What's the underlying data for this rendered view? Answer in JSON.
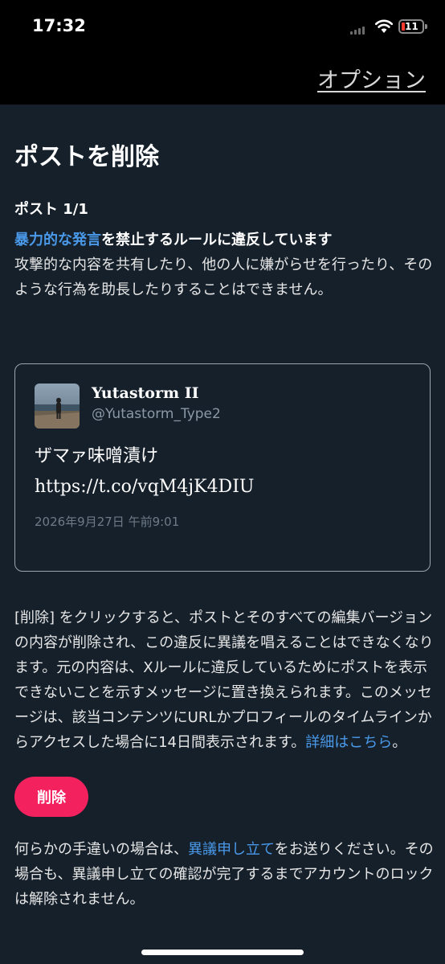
{
  "status_bar": {
    "time": "17:32",
    "battery": "11"
  },
  "header": {
    "options_label": "オプション"
  },
  "page": {
    "title": "ポストを削除",
    "post_count": "ポスト 1/1",
    "violation_link": "暴力的な発言",
    "violation_rest": "を禁止するルールに違反しています",
    "description": "攻撃的な内容を共有したり、他の人に嫌がらせを行ったり、そのような行為を助長したりすることはできません。"
  },
  "tweet": {
    "name": "Yutastorm II",
    "handle": "@Yutastorm_Type2",
    "text_line1": "ザマァ味噌漬け",
    "text_line2": "https://t.co/vqM4jK4DIU",
    "date": "2026年9月27日 午前9:01"
  },
  "explanation": {
    "text": "[削除] をクリックすると、ポストとそのすべての編集バージョンの内容が削除され、この違反に異議を唱えることはできなくなります。元の内容は、Xルールに違反しているためにポストを表示できないことを示すメッセージに置き換えられます。このメッセージは、該当コンテンツにURLかプロフィールのタイムラインからアクセスした場合に14日間表示されます。",
    "details_link": "詳細はこちら",
    "end": "。"
  },
  "actions": {
    "delete_label": "削除"
  },
  "footer": {
    "prefix": "何らかの手違いの場合は、",
    "appeal_link": "異議申し立て",
    "suffix": "をお送りください。その場合も、異議申し立ての確認が完了するまでアカウントのロックは解除されません。"
  },
  "colors": {
    "background": "#15202b",
    "link": "#4a99e9",
    "delete_button": "#f4215f",
    "top_bar": "#000000"
  },
  "icons": [
    "signal-icon",
    "wifi-icon",
    "battery-icon"
  ]
}
